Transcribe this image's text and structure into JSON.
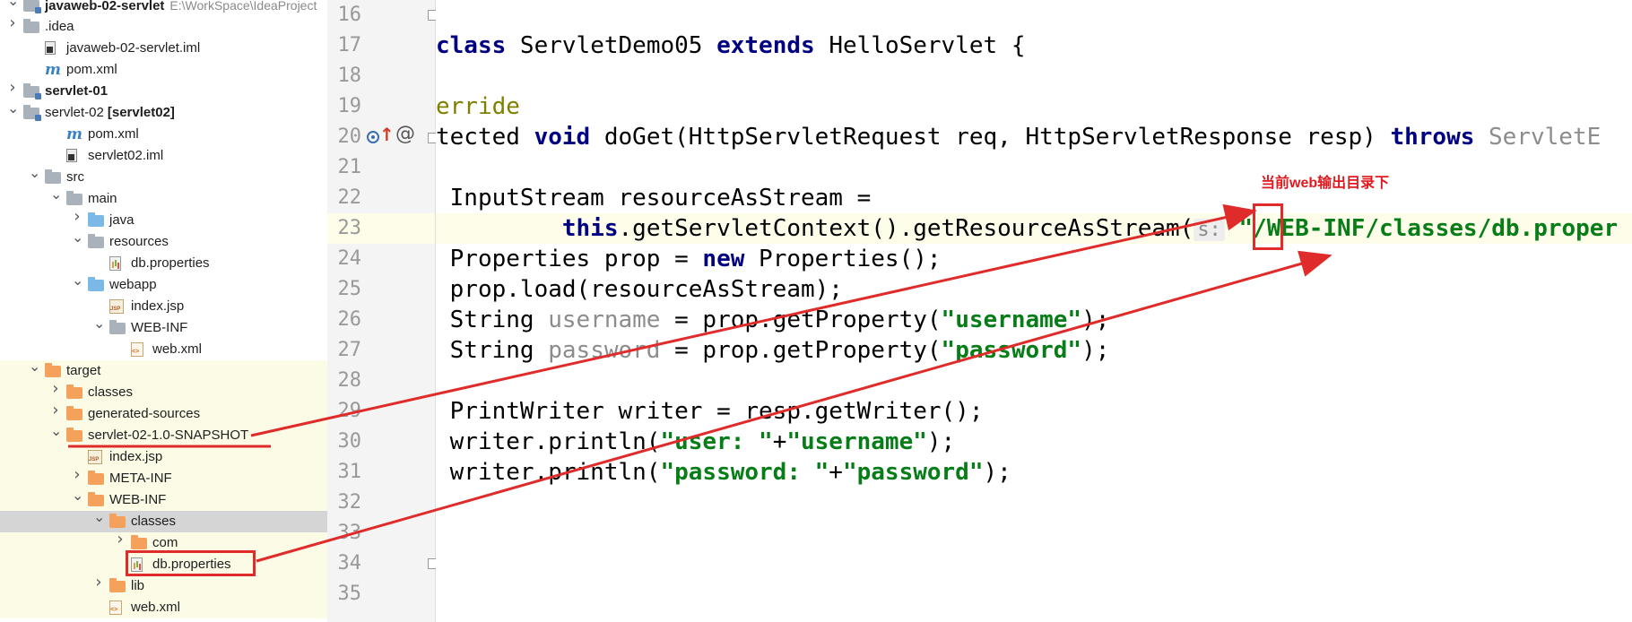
{
  "project_tree": {
    "items": [
      {
        "label": "javaweb-02-servlet",
        "path": "E:\\WorkSpace\\IdeaProject",
        "icon": "module-folder-icon",
        "chevron": "down",
        "bold": true
      },
      {
        "label": ".idea",
        "icon": "folder-icon",
        "chevron": "right"
      },
      {
        "label": "javaweb-02-servlet.iml",
        "icon": "iml-file-icon"
      },
      {
        "label": "pom.xml",
        "icon": "maven-file-icon"
      },
      {
        "label": "servlet-01",
        "icon": "module-folder-icon",
        "chevron": "right",
        "bold": true
      },
      {
        "label": "servlet-02",
        "suffix": "[servlet02]",
        "icon": "module-folder-icon",
        "chevron": "down"
      },
      {
        "label": "pom.xml",
        "icon": "maven-file-icon"
      },
      {
        "label": "servlet02.iml",
        "icon": "iml-file-icon"
      },
      {
        "label": "src",
        "icon": "folder-icon",
        "chevron": "down"
      },
      {
        "label": "main",
        "icon": "folder-icon",
        "chevron": "down"
      },
      {
        "label": "java",
        "icon": "source-folder-icon",
        "chevron": "right"
      },
      {
        "label": "resources",
        "icon": "resources-folder-icon",
        "chevron": "down"
      },
      {
        "label": "db.properties",
        "icon": "properties-file-icon"
      },
      {
        "label": "webapp",
        "icon": "web-folder-icon",
        "chevron": "down"
      },
      {
        "label": "index.jsp",
        "icon": "jsp-file-icon"
      },
      {
        "label": "WEB-INF",
        "icon": "folder-icon",
        "chevron": "down"
      },
      {
        "label": "web.xml",
        "icon": "xml-file-icon"
      },
      {
        "label": "target",
        "icon": "excluded-folder-icon",
        "chevron": "down"
      },
      {
        "label": "classes",
        "icon": "excluded-folder-icon",
        "chevron": "right"
      },
      {
        "label": "generated-sources",
        "icon": "excluded-folder-icon",
        "chevron": "right"
      },
      {
        "label": "servlet-02-1.0-SNAPSHOT",
        "icon": "excluded-folder-icon",
        "chevron": "down"
      },
      {
        "label": "index.jsp",
        "icon": "jsp-file-icon"
      },
      {
        "label": "META-INF",
        "icon": "excluded-folder-icon",
        "chevron": "right"
      },
      {
        "label": "WEB-INF",
        "icon": "excluded-folder-icon",
        "chevron": "down"
      },
      {
        "label": "classes",
        "icon": "excluded-folder-icon",
        "chevron": "down",
        "selected": true
      },
      {
        "label": "com",
        "icon": "excluded-folder-icon",
        "chevron": "right"
      },
      {
        "label": "db.properties",
        "icon": "properties-file-icon"
      },
      {
        "label": "lib",
        "icon": "excluded-folder-icon",
        "chevron": "right"
      },
      {
        "label": "web.xml",
        "icon": "xml-file-icon"
      }
    ]
  },
  "editor": {
    "line_numbers": [
      "16",
      "17",
      "18",
      "19",
      "20",
      "21",
      "22",
      "23",
      "24",
      "25",
      "26",
      "27",
      "28",
      "29",
      "30",
      "31",
      "32",
      "33",
      "34",
      "35"
    ],
    "current_line": "23",
    "code": {
      "l17": {
        "kw1": "class",
        "t1": " ServletDemo05 ",
        "kw2": "extends",
        "t2": " HelloServlet {"
      },
      "l19": {
        "ann": "erride"
      },
      "l20": {
        "t1": "tected ",
        "kw1": "void",
        "t2": " doGet(HttpServletRequest req, HttpServletResponse resp) ",
        "kw2": "throws",
        "t3": " ServletE"
      },
      "l22": {
        "t1": " InputStream resourceAsStream ="
      },
      "l23": {
        "t0": "         ",
        "kw1": "this",
        "t1": ".getServletContext().getResourceAsStream(",
        "hint": "s:",
        "t2": " ",
        "str": "\"/WEB-INF/classes/db.proper"
      },
      "l24": {
        "t1": " Properties prop = ",
        "kw1": "new",
        "t2": " Properties();"
      },
      "l25": {
        "t1": " prop.load(resourceAsStream);"
      },
      "l26": {
        "t1": " String ",
        "g1": "username",
        "t2": " = prop.getProperty(",
        "str": "\"username\"",
        "t3": ");"
      },
      "l27": {
        "t1": " String ",
        "g1": "password",
        "t2": " = prop.getProperty(",
        "str": "\"password\"",
        "t3": ");"
      },
      "l29": {
        "t1": " PrintWriter writer = resp.getWriter();"
      },
      "l30": {
        "t1": " writer.println(",
        "s1": "\"user: \"",
        "t2": "+",
        "s2": "\"username\"",
        "t3": ");"
      },
      "l31": {
        "t1": " writer.println(",
        "s1": "\"password: \"",
        "t2": "+",
        "s2": "\"password\"",
        "t3": ");"
      }
    }
  },
  "annotation": {
    "label": "当前web输出目录下",
    "color": "#e0191e"
  }
}
